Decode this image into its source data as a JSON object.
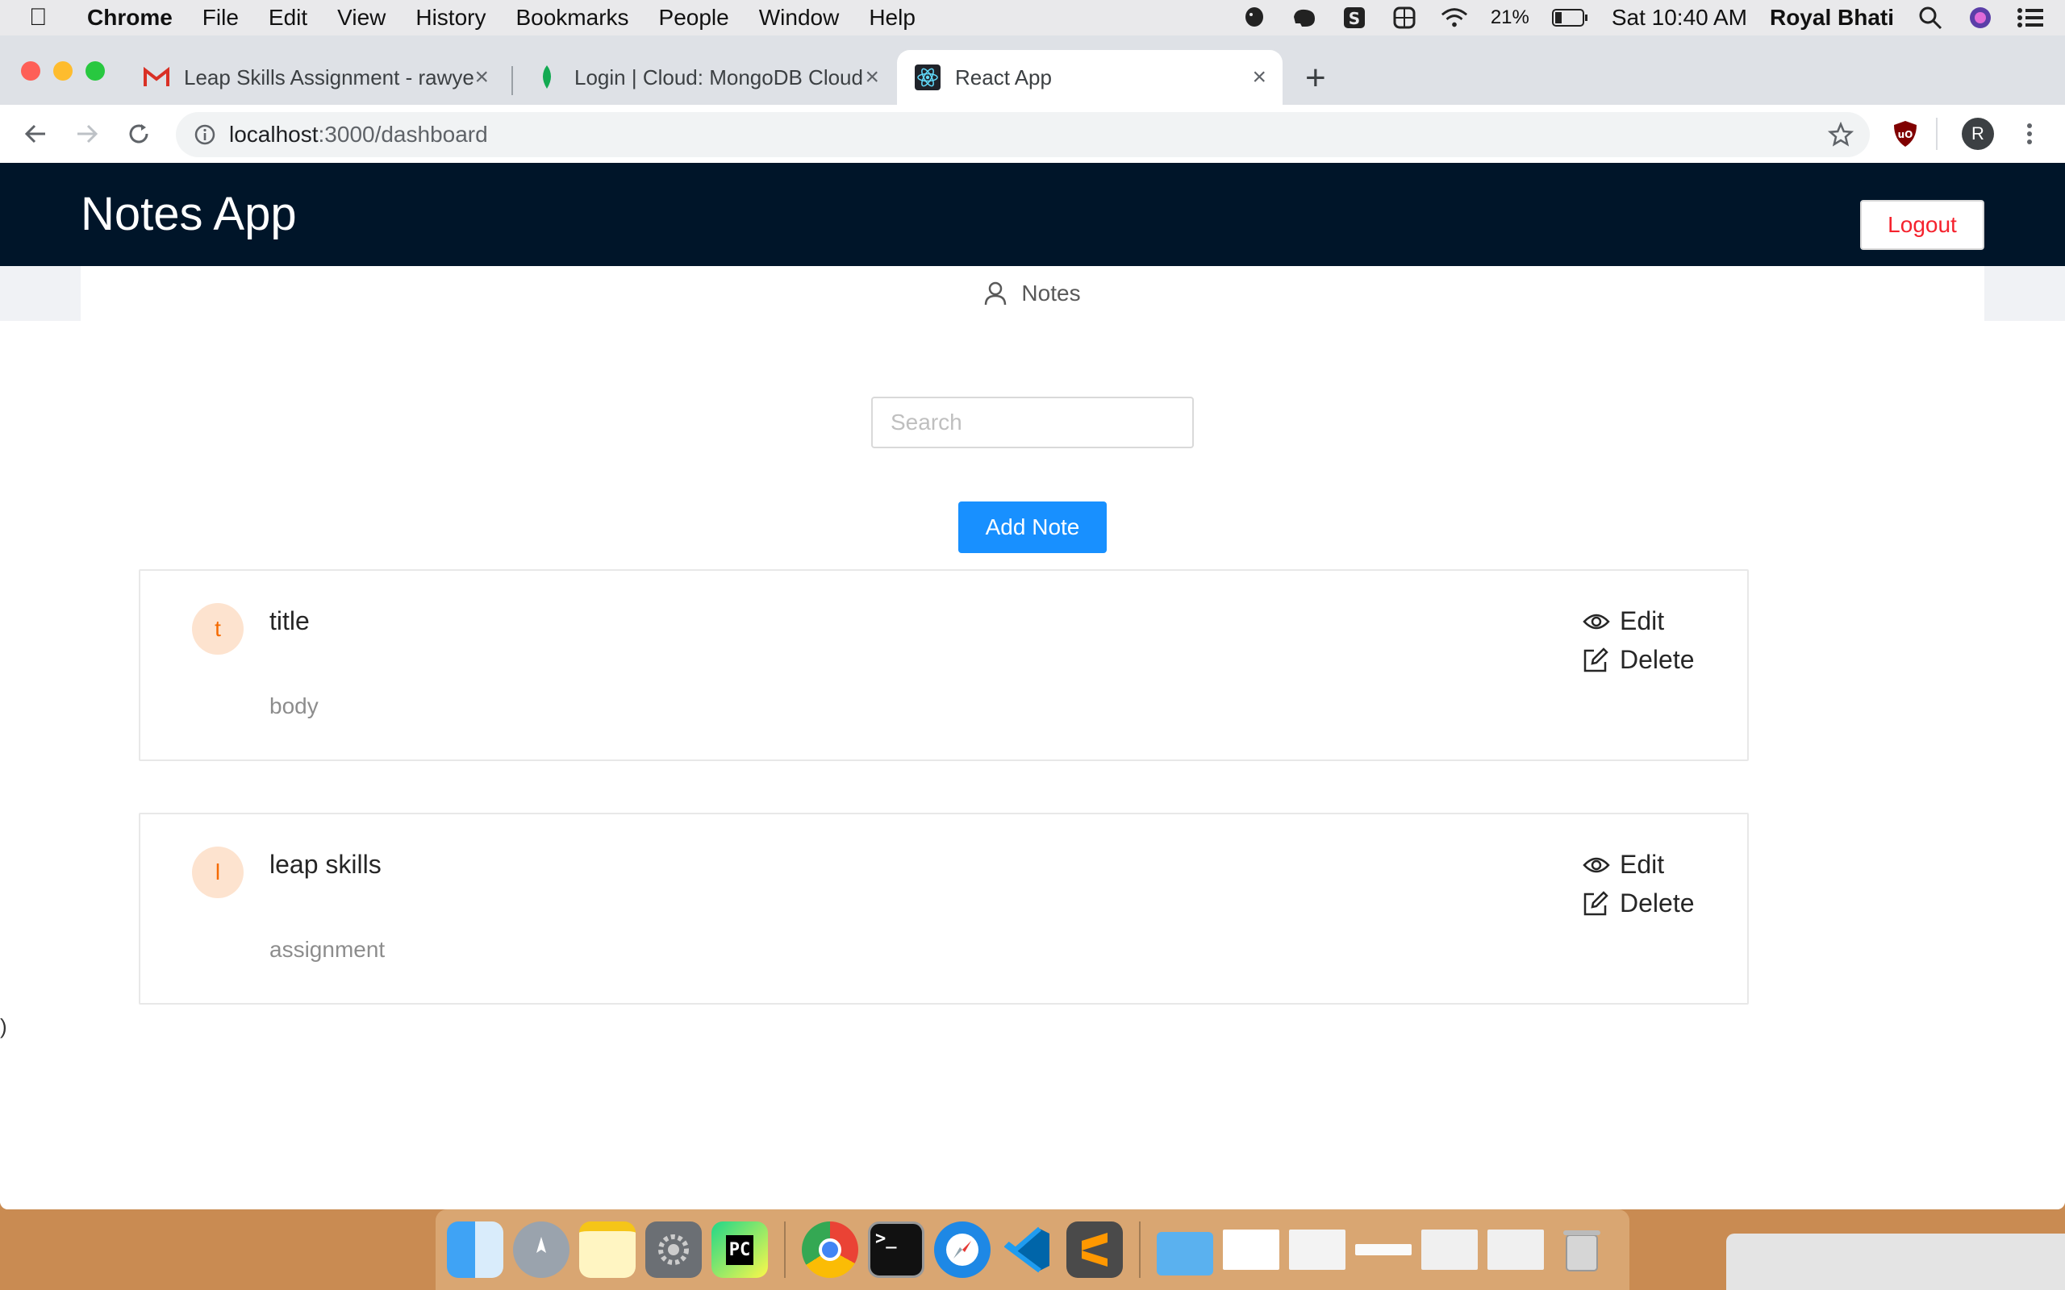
{
  "menubar": {
    "app_name": "Chrome",
    "menus": [
      "File",
      "Edit",
      "View",
      "History",
      "Bookmarks",
      "People",
      "Window",
      "Help"
    ],
    "battery": "21%",
    "clock": "Sat 10:40 AM",
    "user": "Royal Bhati"
  },
  "browser": {
    "tabs": [
      {
        "label": "Leap Skills Assignment - rawye",
        "favicon": "gmail-icon"
      },
      {
        "label": "Login | Cloud: MongoDB Cloud",
        "favicon": "mongodb-leaf-icon"
      },
      {
        "label": "React App",
        "favicon": "react-icon"
      }
    ],
    "url_host": "localhost",
    "url_path": ":3000/dashboard",
    "profile_initial": "R"
  },
  "app": {
    "brand": "Notes App",
    "logout_label": "Logout",
    "menu_label": "Notes",
    "search_placeholder": "Search",
    "add_note_label": "Add Note",
    "stray_text": ")",
    "notes": [
      {
        "avatar": "t",
        "title": "title",
        "body": "body",
        "edit_label": "Edit",
        "delete_label": "Delete"
      },
      {
        "avatar": "l",
        "title": "leap skills",
        "body": "assignment",
        "edit_label": "Edit",
        "delete_label": "Delete"
      }
    ],
    "colors": {
      "header_bg": "#001529",
      "primary": "#1890ff",
      "logout_text": "#f5222d",
      "avatar_bg": "#fde3cf",
      "avatar_text": "#f56a00"
    }
  },
  "dock": {
    "apps": [
      "Finder",
      "Launchpad",
      "Notes",
      "System Preferences",
      "PyCharm",
      "Chrome",
      "Terminal",
      "Safari",
      "VS Code",
      "Sublime Text"
    ]
  }
}
